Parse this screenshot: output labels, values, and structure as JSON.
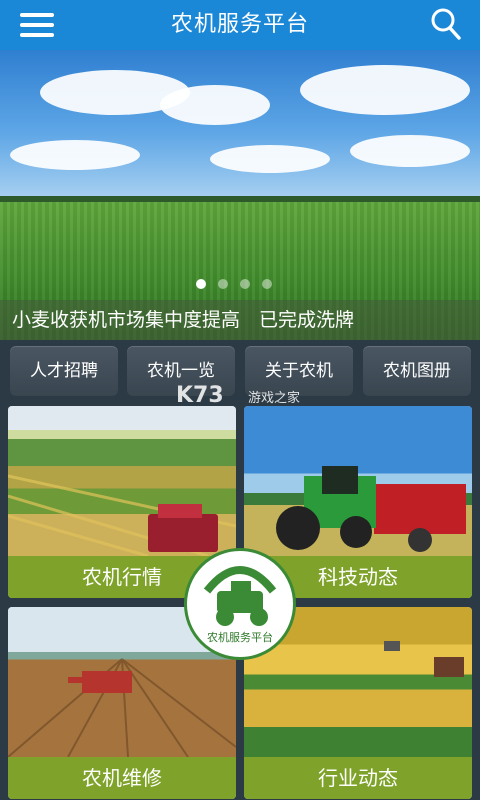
{
  "header": {
    "title": "农机服务平台",
    "menu_icon": "menu-icon",
    "search_icon": "search-icon"
  },
  "banner": {
    "caption": "小麦收获机市场集中度提高　已完成洗牌",
    "slide_count": 4,
    "active_slide": 1
  },
  "nav_buttons": [
    {
      "label": "人才招聘"
    },
    {
      "label": "农机一览"
    },
    {
      "label": "关于农机"
    },
    {
      "label": "农机图册"
    }
  ],
  "watermark": {
    "logo": "K73",
    "text": "游戏之家"
  },
  "tiles": [
    {
      "label": "农机行情"
    },
    {
      "label": "科技动态"
    },
    {
      "label": "农机维修"
    },
    {
      "label": "行业动态"
    }
  ],
  "center_logo": {
    "caption": "农机服务平台"
  },
  "colors": {
    "header": "#1a87d7",
    "tile_label": "#7fa32a",
    "background": "#2b3a45"
  }
}
